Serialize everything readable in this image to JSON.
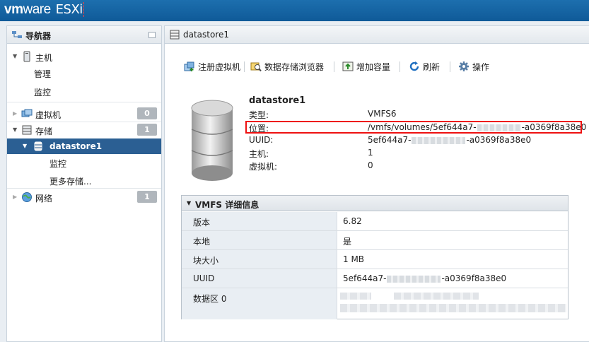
{
  "brand": {
    "vm": "vm",
    "ware": "ware",
    "product": "ESXi"
  },
  "navigator": {
    "title": "导航器",
    "items": [
      {
        "label": "主机"
      },
      {
        "label": "管理"
      },
      {
        "label": "监控"
      },
      {
        "label": "虚拟机",
        "badge": "0"
      },
      {
        "label": "存储",
        "badge": "1"
      },
      {
        "label": "datastore1"
      },
      {
        "label": "监控"
      },
      {
        "label": "更多存储..."
      },
      {
        "label": "网络",
        "badge": "1"
      }
    ]
  },
  "panel": {
    "title": "datastore1",
    "toolbar": {
      "register_vm": "注册虚拟机",
      "browser": "数据存储浏览器",
      "increase": "增加容量",
      "refresh": "刷新",
      "actions": "操作"
    },
    "summary": {
      "name": "datastore1",
      "props": [
        {
          "key": "类型:",
          "value": "VMFS6"
        },
        {
          "key": "位置:",
          "value_prefix": "/vmfs/volumes/5ef644a7-",
          "value_suffix": "-a0369f8a38e0"
        },
        {
          "key": "UUID:",
          "value_prefix": "5ef644a7-",
          "value_suffix": "-a0369f8a38e0"
        },
        {
          "key": "主机:",
          "value": "1"
        },
        {
          "key": "虚拟机:",
          "value": "0"
        }
      ]
    },
    "vmfs": {
      "title": "VMFS 详细信息",
      "rows": [
        {
          "key": "版本",
          "value": "6.82"
        },
        {
          "key": "本地",
          "value": "是"
        },
        {
          "key": "块大小",
          "value": "1 MB"
        },
        {
          "key": "UUID",
          "value_prefix": "5ef644a7-",
          "value_suffix": "-a0369f8a38e0"
        },
        {
          "key": "数据区 0",
          "value": ""
        }
      ]
    }
  }
}
